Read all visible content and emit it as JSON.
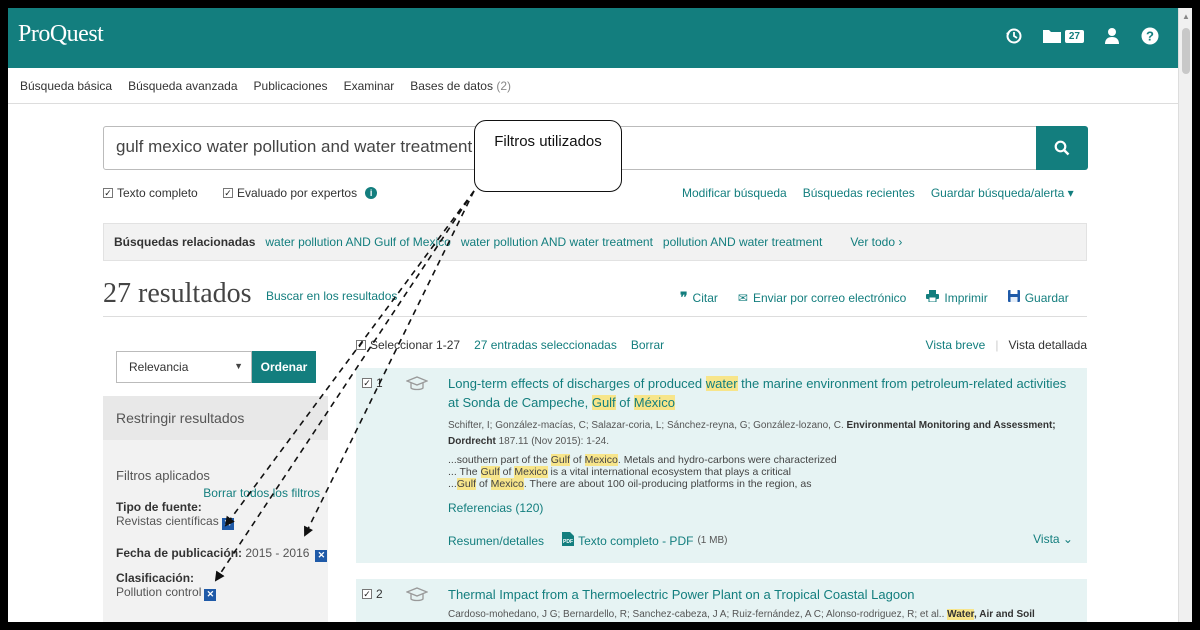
{
  "header": {
    "brand": "ProQuest",
    "folder_count": "27",
    "icons": [
      "history-icon",
      "folder-icon",
      "user-icon",
      "help-icon"
    ]
  },
  "nav": {
    "items": [
      {
        "label": "Búsqueda básica"
      },
      {
        "label": "Búsqueda avanzada"
      },
      {
        "label": "Publicaciones"
      },
      {
        "label": "Examinar"
      },
      {
        "label": "Bases de datos",
        "suffix": "(2)"
      }
    ]
  },
  "search": {
    "query": "gulf mexico water pollution and water treatment",
    "full_text_label": "Texto completo",
    "peer_reviewed_label": "Evaluado por expertos",
    "modify_label": "Modificar búsqueda",
    "recent_label": "Búsquedas recientes",
    "save_label": "Guardar búsqueda/alerta ▾"
  },
  "related": {
    "label": "Búsquedas relacionadas",
    "items": [
      "water pollution AND Gulf of Mexico",
      "water pollution AND water treatment",
      "pollution AND water treatment"
    ],
    "see_all": "Ver todo ›"
  },
  "results": {
    "count_text": "27 resultados",
    "search_within": "Buscar en los resultados",
    "cite": "Citar",
    "email": "Enviar por correo electrónico",
    "print": "Imprimir",
    "save": "Guardar"
  },
  "sort": {
    "selected": "Relevancia",
    "button": "Ordenar"
  },
  "sidebar": {
    "restrict": "Restringir resultados",
    "applied": "Filtros aplicados",
    "clear_all": "Borrar todos los filtros",
    "source_type_label": "Tipo de fuente:",
    "source_type_value": "Revistas científicas",
    "date_label": "Fecha de publicación:",
    "date_value": "2015 - 2016",
    "class_label": "Clasificación:",
    "class_value": "Pollution control"
  },
  "selection": {
    "select_range": "Seleccionar 1-27",
    "selected_count": "27 entradas seleccionadas",
    "clear": "Borrar",
    "brief_view": "Vista breve",
    "detailed_view": "Vista detallada"
  },
  "records": [
    {
      "num": "1",
      "title_parts": [
        "Long-term effects of discharges of produced ",
        "water",
        " the marine environment from petroleum-related activities at Sonda de Campeche, ",
        "Gulf",
        " of ",
        "México"
      ],
      "authors": "Schifter, I; González-macías, C; Salazar-coria, L; Sánchez-reyna, G; González-lozano, C.",
      "journal": "Environmental Monitoring and Assessment; Dordrecht",
      "citation": "187.11 (Nov 2015): 1-24.",
      "snippet_1": "...southern part of the Gulf of Mexico. Metals and hydro-carbons were characterized",
      "snippet_2": "... The Gulf of Mexico is a vital international ecosystem that plays a critical",
      "snippet_3": "...Gulf of Mexico. There are about 100 oil-producing platforms in the region, as",
      "refs": "Referencias (120)",
      "abstract": "Resumen/detalles",
      "fulltext": "Texto completo - PDF",
      "size": "(1 MB)",
      "vista": "Vista ⌄"
    },
    {
      "num": "2",
      "title": "Thermal Impact from a Thermoelectric Power Plant on a Tropical Coastal Lagoon",
      "authors": "Cardoso-mohedano, J G; Bernardello, R; Sanchez-cabeza, J A; Ruiz-fernández, A C; Alonso-rodriguez, R; et al..",
      "journal_hl": "Water",
      "journal_rest": ", Air and Soil"
    }
  ],
  "annotation": {
    "callout": "Filtros utilizados"
  },
  "colors": {
    "brand": "#137e7e",
    "highlight": "#f7e58a",
    "record_bg": "#e6f3f3",
    "remove_filter": "#1f5aa8"
  }
}
